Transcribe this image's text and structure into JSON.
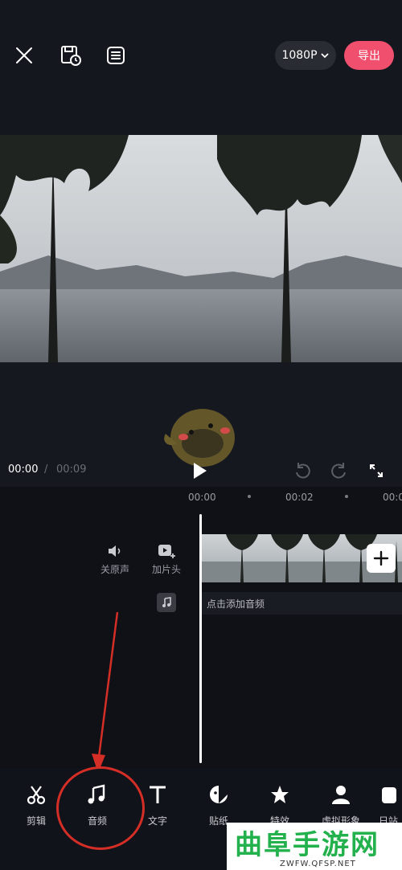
{
  "header": {
    "resolution": "1080P",
    "export_label": "导出",
    "icons": [
      "close-icon",
      "draft-save-icon",
      "list-icon",
      "chevron-down-icon"
    ]
  },
  "player": {
    "current_time": "00:00",
    "separator": "/",
    "total_time": "00:09",
    "icons": [
      "play-icon",
      "undo-icon",
      "redo-icon",
      "fullscreen-icon"
    ]
  },
  "timeline": {
    "ruler": [
      "00:00",
      "00:02",
      "00:0"
    ],
    "mute_label": "关原声",
    "intro_label": "加片头",
    "audio_hint": "点击添加音频"
  },
  "toolbar": {
    "items": [
      {
        "label": "剪辑",
        "icon": "scissors-icon"
      },
      {
        "label": "音频",
        "icon": "music-note-icon"
      },
      {
        "label": "文字",
        "icon": "text-icon"
      },
      {
        "label": "贴纸",
        "icon": "sticker-icon"
      },
      {
        "label": "特效",
        "icon": "effects-star-icon"
      },
      {
        "label": "虚拟形象",
        "icon": "avatar-icon"
      },
      {
        "label": "日站",
        "icon": "more-icon"
      }
    ]
  },
  "watermark": {
    "title": "曲阜手游网",
    "url": "ZWFW.QFSP.NET"
  },
  "colors": {
    "accent": "#f0506e",
    "annotation": "#d42e26",
    "watermark": "#22b14c"
  }
}
